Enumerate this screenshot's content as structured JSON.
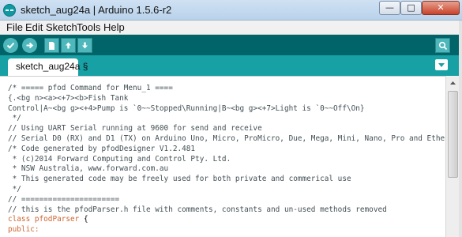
{
  "window": {
    "title": "sketch_aug24a | Arduino 1.5.6-r2",
    "minimize_glyph": "—",
    "maximize_glyph": "□",
    "close_glyph": "✕"
  },
  "menu": {
    "items": [
      "File",
      "Edit",
      "Sketch",
      "Tools",
      "Help"
    ]
  },
  "toolbar": {
    "buttons": [
      "verify-icon",
      "upload-icon",
      "new-icon",
      "open-icon",
      "save-icon",
      "serial-monitor-icon"
    ]
  },
  "tabs": {
    "active": "sketch_aug24a §",
    "menu_icon": "triangle-down-icon"
  },
  "colors": {
    "toolbar": "#006468",
    "tabstrip": "#17a1a5",
    "button": "#4db7bb",
    "keyword": "#cc6633",
    "comment": "#434f54"
  },
  "editor": {
    "lines": [
      {
        "text": "/* ===== pfod Command for Menu_1 ====",
        "type": "comment"
      },
      {
        "text": "{.<bg n><a><+7><b>Fish Tank",
        "type": "comment"
      },
      {
        "text": "Control|A~<bg g><+4>Pump is `0~~Stopped\\Running|B~<bg g><+7>Light is `0~~Off\\On}",
        "type": "comment"
      },
      {
        "text": " */",
        "type": "comment"
      },
      {
        "text": "// Using UART Serial running at 9600 for send and receive",
        "type": "comment"
      },
      {
        "text": "// Serial D0 (RX) and D1 (TX) on Arduino Uno, Micro, ProMicro, Due, Mega, Mini, Nano, Pro and Ethernet",
        "type": "comment"
      },
      {
        "text": "/* Code generated by pfodDesigner V1.2.481",
        "type": "comment"
      },
      {
        "text": " * (c)2014 Forward Computing and Control Pty. Ltd.",
        "type": "comment"
      },
      {
        "text": " * NSW Australia, www.forward.com.au",
        "type": "comment"
      },
      {
        "text": " * This generated code may be freely used for both private and commerical use",
        "type": "comment"
      },
      {
        "text": " */",
        "type": "comment"
      },
      {
        "text": "// ======================",
        "type": "comment"
      },
      {
        "text": "// this is the pfodParser.h file with comments, constants and un-used methods removed",
        "type": "comment"
      },
      {
        "parts": [
          {
            "text": "class pfodParser",
            "type": "kw"
          },
          {
            "text": " {",
            "type": "plain"
          }
        ]
      },
      {
        "text": "public:",
        "type": "kw"
      }
    ]
  }
}
